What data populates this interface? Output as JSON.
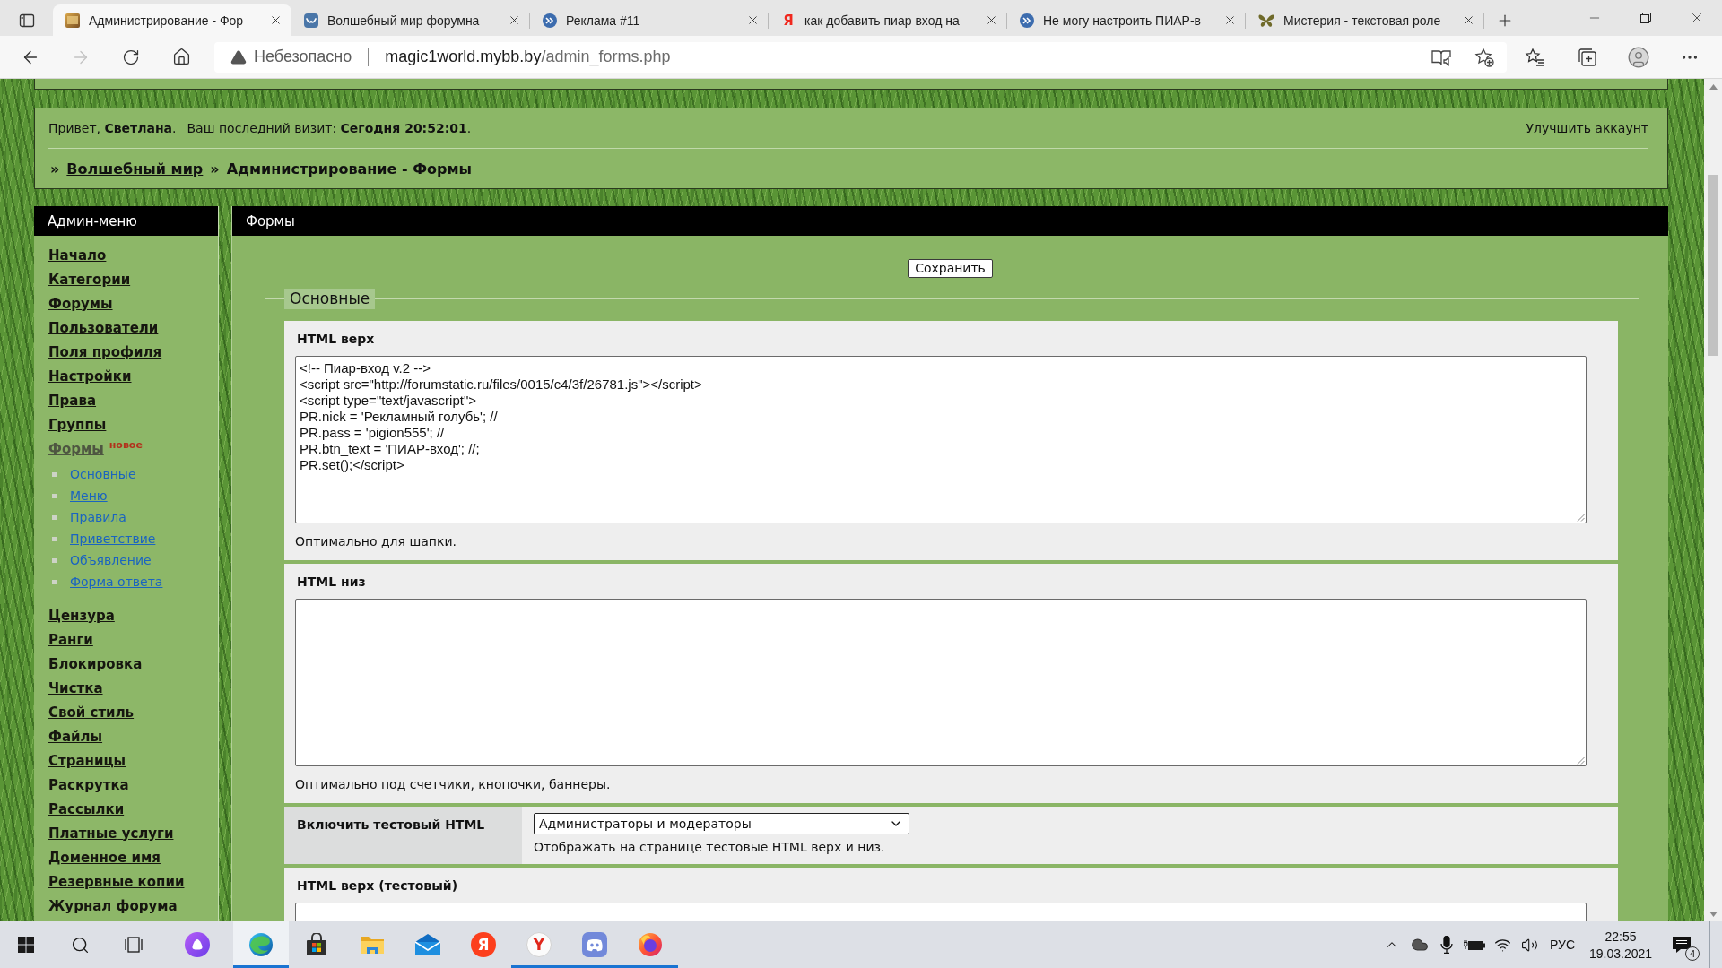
{
  "browser": {
    "tabs": [
      {
        "title": "Администрирование - Фор",
        "selected": true
      },
      {
        "title": "Волшебный мир форумна",
        "selected": false
      },
      {
        "title": "Реклама #11",
        "selected": false
      },
      {
        "title": "как добавить пиар вход на",
        "selected": false,
        "favicon_glyph": "Я"
      },
      {
        "title": "Не могу настроить ПИАР-в",
        "selected": false
      },
      {
        "title": "Мистерия - текстовая роле",
        "selected": false
      }
    ],
    "forward_disabled": true,
    "security_label": "Небезопасно",
    "url_host": "magic1world.mybb.by",
    "url_path": "/admin_forms.php"
  },
  "page": {
    "welcome": {
      "greeting": "Привет, **Светлана**.",
      "last_visit": "Ваш последний визит: **Сегодня 20:52:01**.",
      "upgrade_link": "Улучшить аккаунт"
    },
    "breadcrumbs": [
      {
        "separator": "»",
        "label": "Волшебный мир",
        "link": true
      },
      {
        "separator": "»",
        "label": "Администрирование - Формы",
        "link": false
      }
    ],
    "sidebar": {
      "title": "Админ-меню",
      "items": [
        {
          "label": "Начало",
          "selected": false
        },
        {
          "label": "Категории",
          "selected": false
        },
        {
          "label": "Форумы",
          "selected": false
        },
        {
          "label": "Пользователи",
          "selected": false
        },
        {
          "label": "Поля профиля",
          "selected": false
        },
        {
          "label": "Настройки",
          "selected": false
        },
        {
          "label": "Права",
          "selected": false
        },
        {
          "label": "Группы",
          "selected": false
        },
        {
          "label": "Формы",
          "selected": true,
          "badge": "новое",
          "children": [
            {
              "label": "Основные"
            },
            {
              "label": "Меню"
            },
            {
              "label": "Правила"
            },
            {
              "label": "Приветствие"
            },
            {
              "label": "Объявление"
            },
            {
              "label": "Форма ответа"
            }
          ]
        },
        {
          "label": "Цензура",
          "selected": false
        },
        {
          "label": "Ранги",
          "selected": false
        },
        {
          "label": "Блокировка",
          "selected": false
        },
        {
          "label": "Чистка",
          "selected": false
        },
        {
          "label": "Свой стиль",
          "selected": false
        },
        {
          "label": "Файлы",
          "selected": false
        },
        {
          "label": "Страницы",
          "selected": false
        },
        {
          "label": "Раскрутка",
          "selected": false
        },
        {
          "label": "Рассылки",
          "selected": false
        },
        {
          "label": "Платные услуги",
          "selected": false
        },
        {
          "label": "Доменное имя",
          "selected": false
        },
        {
          "label": "Резервные копии",
          "selected": false
        },
        {
          "label": "Журнал форума",
          "selected": false
        }
      ]
    },
    "main": {
      "title": "Формы",
      "save_button": "Сохранить",
      "fieldset": {
        "legend": "Основные",
        "rows": [
          {
            "kind": "textarea",
            "label": "HTML верх",
            "value": "<!-- Пиар-вход v.2 -->\n<script src=\"http://forumstatic.ru/files/0015/c4/3f/26781.js\"></script>\n<script type=\"text/javascript\">\nPR.nick = 'Рекламный голубь'; //\nPR.pass = 'pigion555'; //\nPR.btn_text = 'ПИАР-вход'; //;\nPR.set();</script>",
            "note": "Оптимально для шапки."
          },
          {
            "kind": "textarea",
            "label": "HTML низ",
            "note": "Оптимально под счетчики, кнопочки, баннеры."
          },
          {
            "kind": "select",
            "label": "Включить тестовый HTML",
            "value": "Администраторы и модераторы",
            "note": "Отображать на странице тестовые HTML верх и низ."
          },
          {
            "kind": "textarea",
            "label": "HTML верх (тестовый)"
          }
        ]
      }
    }
  },
  "taskbar": {
    "apps": [
      {
        "selected": true,
        "running": true
      },
      {
        "selected": false,
        "running": false
      },
      {
        "selected": false,
        "running": false
      },
      {
        "selected": false,
        "running": false
      },
      {
        "selected": false,
        "running": false,
        "glyph": "Я"
      },
      {
        "selected": false,
        "running": true,
        "glyph": "Y"
      },
      {
        "selected": false,
        "running": true
      },
      {
        "selected": false,
        "running": true
      }
    ],
    "language": "РУС",
    "time": "22:55",
    "date": "19.03.2021",
    "notifications": "4"
  }
}
